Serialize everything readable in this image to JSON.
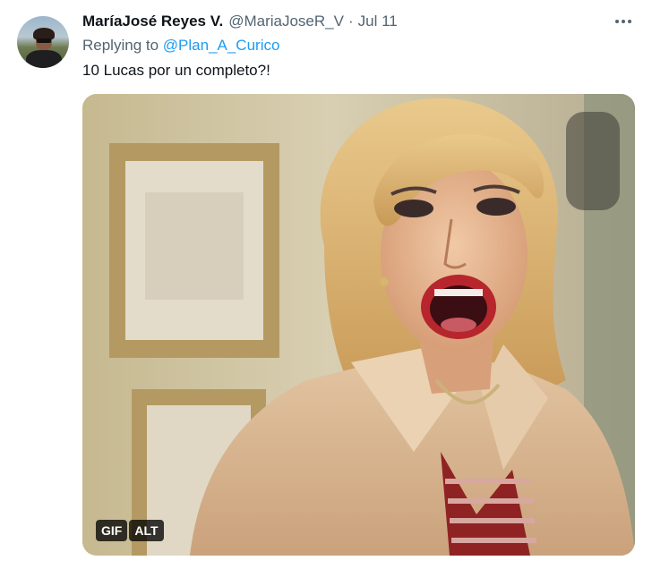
{
  "tweet": {
    "author_name": "MaríaJosé Reyes V.",
    "author_handle": "@MariaJoseR_V",
    "separator": "·",
    "date": "Jul 11",
    "replying_prefix": "Replying to ",
    "replying_to": "@Plan_A_Curico",
    "text": "10 Lucas por un completo?!",
    "more_icon": "more-horizontal-icon"
  },
  "media": {
    "type": "gif",
    "badges": {
      "gif": "GIF",
      "alt": "ALT"
    }
  },
  "colors": {
    "text_primary": "#0f1419",
    "text_secondary": "#536471",
    "link": "#1d9bf0",
    "background": "#ffffff"
  }
}
